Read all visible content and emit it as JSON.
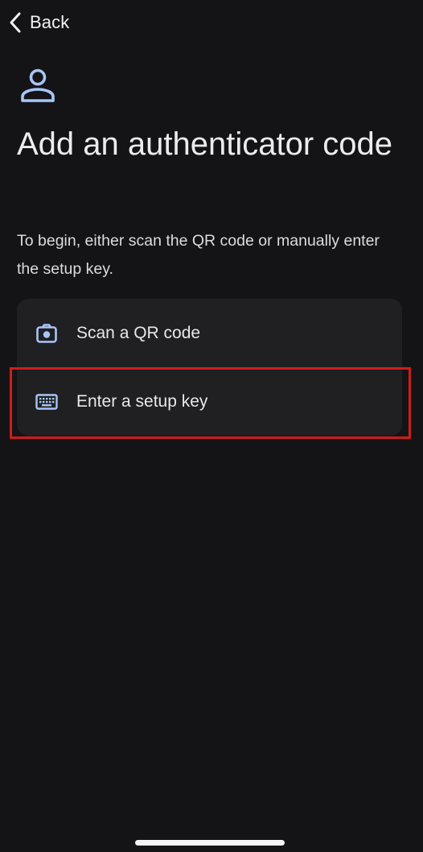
{
  "nav": {
    "back_label": "Back",
    "back_icon": "chevron-left-icon"
  },
  "header": {
    "icon": "person-icon",
    "title": "Add an authenticator code",
    "description": "To begin, either scan the QR code or manually enter the setup key."
  },
  "options": [
    {
      "label": "Scan a QR code",
      "icon": "camera-icon"
    },
    {
      "label": "Enter a setup key",
      "icon": "keyboard-icon",
      "highlighted": true
    }
  ],
  "colors": {
    "background": "#141416",
    "card": "#202022",
    "accent_icon": "#a8c5f7",
    "highlight_border": "#d01c1c",
    "text": "#e8e8ea"
  }
}
